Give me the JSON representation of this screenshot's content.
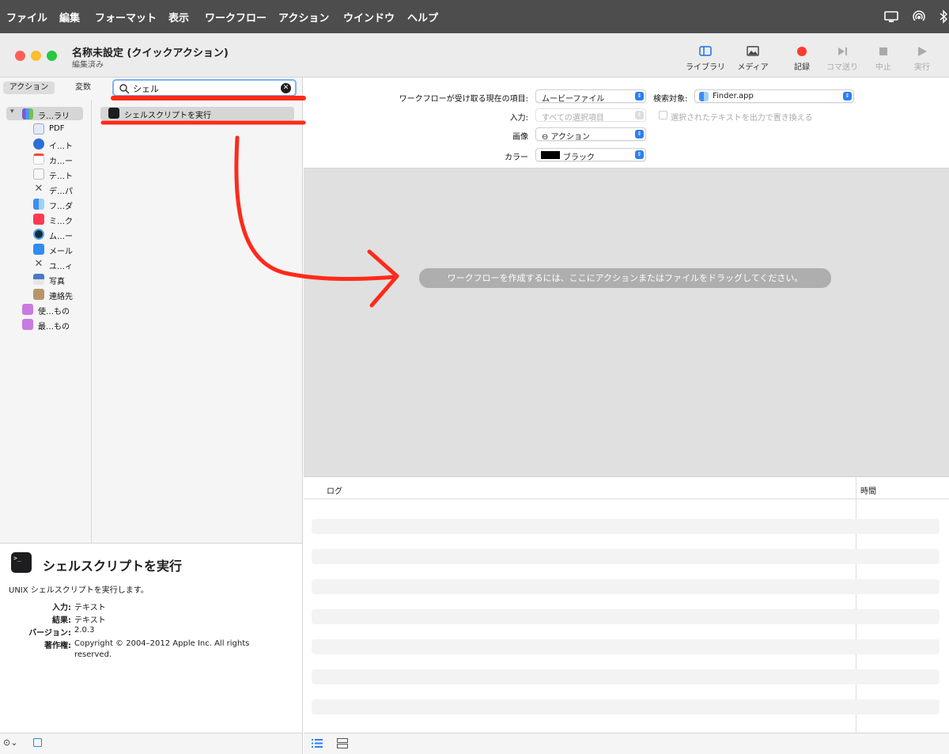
{
  "menubar": {
    "items": [
      "ファイル",
      "編集",
      "フォーマット",
      "表示",
      "ワークフロー",
      "アクション",
      "ウインドウ",
      "ヘルプ"
    ],
    "right_icons": [
      "display-icon",
      "airdrop-icon",
      "bluetooth-icon"
    ]
  },
  "window": {
    "title": "名称未設定 (クイックアクション)",
    "subtitle": "編集済み"
  },
  "toolbar": {
    "library": "ライブラリ",
    "media": "メディア",
    "record": "記録",
    "step": "コマ送り",
    "stop": "中止",
    "run": "実行",
    "record_color": "#ff3b30"
  },
  "library": {
    "tab_actions": "アクション",
    "tab_variables": "変数",
    "search_value": "シェル",
    "tree": [
      {
        "label": "ラ…ラリ",
        "icon": "library-icon"
      },
      {
        "label": "PDF",
        "icon": "pdf-icon"
      },
      {
        "label": "イ…ト",
        "icon": "internet-icon"
      },
      {
        "label": "カ…ー",
        "icon": "calendar-icon"
      },
      {
        "label": "テ…ト",
        "icon": "text-icon"
      },
      {
        "label": "デ…パ",
        "icon": "developer-icon"
      },
      {
        "label": "フ…ダ",
        "icon": "finder-icon"
      },
      {
        "label": "ミ…ク",
        "icon": "music-icon"
      },
      {
        "label": "ム…ー",
        "icon": "movie-icon"
      },
      {
        "label": "メール",
        "icon": "mail-icon"
      },
      {
        "label": "ユ…ィ",
        "icon": "utilities-icon"
      },
      {
        "label": "写真",
        "icon": "photos-icon"
      },
      {
        "label": "連絡先",
        "icon": "contacts-icon"
      },
      {
        "label": "使…もの",
        "icon": "smart-folder-icon"
      },
      {
        "label": "最…もの",
        "icon": "smart-folder-icon"
      }
    ],
    "results": [
      "シェルスクリプトを実行"
    ]
  },
  "description": {
    "title": "シェルスクリプトを実行",
    "summary": "UNIX シェルスクリプトを実行します。",
    "input_key": "入力:",
    "input_val": "テキスト",
    "result_key": "結果:",
    "result_val": "テキスト",
    "version_key": "バージョン:",
    "version_val": "2.0.3",
    "copyright_key": "著作権:",
    "copyright_val": "Copyright © 2004–2012 Apple Inc.  All rights reserved."
  },
  "settings": {
    "receives_label": "ワークフローが受け取る現在の項目:",
    "receives_value": "ムービーファイル",
    "in_label": "検索対象:",
    "in_value": "Finder.app",
    "input_label": "入力:",
    "input_value": "すべての選択項目",
    "replace_label": "選択されたテキストを出力で置き換える",
    "image_label": "画像",
    "image_value": "⊖ アクション",
    "color_label": "カラー",
    "color_value": "ブラック",
    "color_swatch": "#000000"
  },
  "canvas": {
    "hint": "ワークフローを作成するには、ここにアクションまたはファイルをドラッグしてください。"
  },
  "log": {
    "col_log": "ログ",
    "col_time": "時間"
  },
  "annotation": {
    "color": "#ff2a1a"
  }
}
